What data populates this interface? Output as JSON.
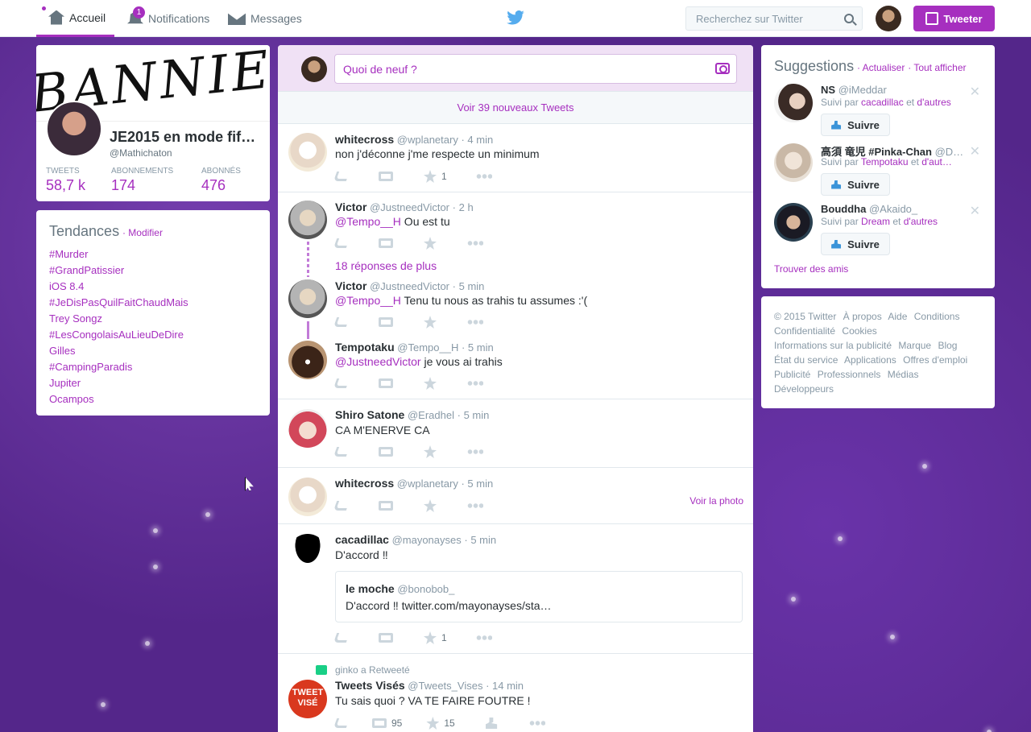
{
  "nav": {
    "home": "Accueil",
    "notifications": "Notifications",
    "notif_count": "1",
    "messages": "Messages",
    "search_placeholder": "Recherchez sur Twitter",
    "tweet_button": "Tweeter"
  },
  "profile": {
    "banner_text": "BANNIERE",
    "name": "JE2015 en mode fif…",
    "handle": "@Mathichaton",
    "stats": [
      {
        "label": "TWEETS",
        "value": "58,7 k"
      },
      {
        "label": "ABONNEMENTS",
        "value": "174"
      },
      {
        "label": "ABONNÉS",
        "value": "476"
      }
    ]
  },
  "trends": {
    "title": "Tendances",
    "modify": "· Modifier",
    "items": [
      "#Murder",
      "#GrandPatissier",
      "iOS 8.4",
      "#JeDisPasQuilFaitChaudMais",
      "Trey Songz",
      "#LesCongolaisAuLieuDeDire",
      "Gilles",
      "#CampingParadis",
      "Jupiter",
      "Ocampos"
    ]
  },
  "compose": {
    "placeholder": "Quoi de neuf ?",
    "new_tweets": "Voir 39 nouveaux Tweets"
  },
  "tweets": [
    {
      "name": "whitecross",
      "handle": "@wplanetary",
      "time": "· 4 min",
      "text": "non j'déconne j'me respecte un minimum",
      "fav_count": "1"
    },
    {
      "name": "Victor",
      "handle": "@JustneedVictor",
      "time": "· 2 h",
      "mention": "@Tempo__H",
      "text": " Ou est tu"
    },
    {
      "more_replies": "18 réponses de plus"
    },
    {
      "name": "Victor",
      "handle": "@JustneedVictor",
      "time": "· 5 min",
      "mention": "@Tempo__H",
      "text": " Tenu tu nous as trahis tu assumes :'("
    },
    {
      "name": "Tempotaku",
      "handle": "@Tempo__H",
      "time": "· 5 min",
      "mention": "@JustneedVictor",
      "text": " je vous ai trahis"
    },
    {
      "name": "Shiro Satone",
      "handle": "@Eradhel",
      "time": "· 5 min",
      "text": "CA M'ENERVE CA"
    },
    {
      "name": "whitecross",
      "handle": "@wplanetary",
      "time": "· 5 min",
      "photo_link": "Voir la photo"
    },
    {
      "name": "cacadillac",
      "handle": "@mayonayses",
      "time": "· 5 min",
      "text": "D'accord ‼",
      "quote_name": "le moche",
      "quote_handle": "@bonobob_",
      "quote_text": "D'accord ‼ twitter.com/mayonayses/sta…",
      "fav_count": "1"
    },
    {
      "retweeted_by": "ginko a Retweeté",
      "name": "Tweets Visés",
      "handle": "@Tweets_Vises",
      "time": "· 14 min",
      "text": "Tu sais quoi ? VA TE FAIRE FOUTRE !",
      "rt_count": "95",
      "fav_count": "15",
      "avatar_text": "TWEET VISÉ"
    }
  ],
  "suggestions": {
    "title": "Suggestions",
    "refresh": "· Actualiser",
    "see_all": "· Tout afficher",
    "items": [
      {
        "name": "NS",
        "handle": "@iMeddar",
        "by_prefix": "Suivi par ",
        "by": "cacadillac",
        "and": " et ",
        "others": "d'autres"
      },
      {
        "name": "高須 竜児 #Pinka-Chan",
        "handle": "@D…",
        "by_prefix": "Suivi par ",
        "by": "Tempotaku",
        "and": " et ",
        "others": "d'aut…"
      },
      {
        "name": "Bouddha",
        "handle": "@Akaido_",
        "by_prefix": "Suivi par ",
        "by": "Dream",
        "and": " et ",
        "others": "d'autres"
      }
    ],
    "follow_label": "Suivre",
    "find_friends": "Trouver des amis"
  },
  "footer": {
    "links": [
      "© 2015 Twitter",
      "À propos",
      "Aide",
      "Conditions",
      "Confidentialité",
      "Cookies",
      "Informations sur la publicité",
      "Marque",
      "Blog",
      "État du service",
      "Applications",
      "Offres d'emploi",
      "Publicité",
      "Professionnels",
      "Médias",
      "Développeurs"
    ]
  },
  "colors": {
    "accent": "#a62fbf",
    "background": "#54268a"
  }
}
